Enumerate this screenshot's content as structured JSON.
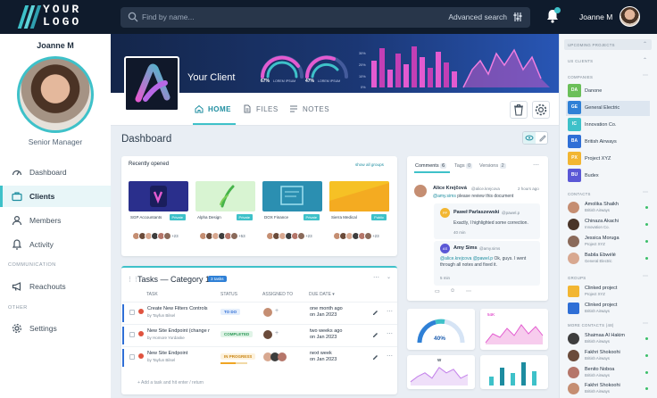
{
  "app": {
    "logo_text": "YOUR LOGO",
    "search": {
      "placeholder": "Find by name...",
      "advanced_label": "Advanced search"
    },
    "user_name": "Joanne M"
  },
  "sidebar": {
    "name": "Joanne M",
    "role": "Senior Manager",
    "items": [
      {
        "label": "Dashboard",
        "icon": "dashboard-icon"
      },
      {
        "label": "Clients",
        "icon": "briefcase-icon",
        "active": true
      },
      {
        "label": "Members",
        "icon": "user-icon"
      },
      {
        "label": "Activity",
        "icon": "bell-icon"
      }
    ],
    "section_communication": "COMMUNICATION",
    "communication_items": [
      {
        "label": "Reachouts",
        "icon": "megaphone-icon"
      }
    ],
    "section_other": "OTHER",
    "other_items": [
      {
        "label": "Settings",
        "icon": "gear-icon"
      }
    ]
  },
  "client": {
    "name": "Your Client",
    "hero_stats": [
      {
        "value": "67%",
        "label": "LOREM IPSUM"
      },
      {
        "value": "47%",
        "label": "LOREM IPSUM"
      }
    ],
    "hero_axis": [
      "30%",
      "20%",
      "10%",
      "0%"
    ],
    "tabs": [
      {
        "label": "HOME",
        "icon": "home-icon",
        "active": true
      },
      {
        "label": "FILES",
        "icon": "file-icon"
      },
      {
        "label": "NOTES",
        "icon": "notes-icon"
      }
    ]
  },
  "dashboard": {
    "title": "Dashboard",
    "recently_opened": {
      "title": "Recently opened",
      "view_all": "show all groups",
      "items": [
        {
          "name": "SGP Accountants",
          "badge": "Private",
          "count": "+23",
          "thumb": "#2a2f8c"
        },
        {
          "name": "Alpha Design",
          "badge": "Private",
          "count": "+53",
          "thumb": "#d8f4d2"
        },
        {
          "name": "DOX Finance",
          "badge": "Private",
          "count": "+23",
          "thumb": "#2b8fb1"
        },
        {
          "name": "Sierra Medical",
          "badge": "Public",
          "count": "+23",
          "thumb": "#f6c125"
        }
      ]
    },
    "tasks": {
      "title": "Tasks — Category 1",
      "count_badge": "3 tasks",
      "columns": [
        "TASK",
        "STATUS",
        "ASSIGNED TO",
        "DUE DATE ▾"
      ],
      "rows": [
        {
          "title": "Create New Filters Controls",
          "by": "by Tayfun Bilsel",
          "status": "TO DO",
          "status_color": "#2f6fd6",
          "status_bg": "#e4eefc",
          "due": "one month ago",
          "due_date": "on Jan 2023"
        },
        {
          "title": "New Site Endpoint (change r",
          "by": "by Homore Yordaske",
          "status": "COMPLETED",
          "status_color": "#2e9a58",
          "status_bg": "#e0f4e7",
          "due": "two weeks ago",
          "due_date": "on Jan 2023"
        },
        {
          "title": "New Site Endpoint",
          "by": "by Tayfun Bilsel",
          "status": "IN PROGRESS",
          "status_color": "#c98410",
          "status_bg": "#fdf2dd",
          "due": "next week",
          "due_date": "on Jan 2023"
        }
      ],
      "add_placeholder": "Add a task and hit enter / return"
    },
    "comments": {
      "tabs": [
        "Comments",
        "Tags",
        "Versions"
      ],
      "tab_counts": [
        "6",
        "0",
        "2"
      ],
      "thread": [
        {
          "author": "Alice Krejčová",
          "handle": "@alice.krejcova",
          "time": "2 hours ago",
          "mention": "@amy.sims",
          "text": "please review this document"
        },
        {
          "author": "Paweł Parlaszewski",
          "handle": "@pawel.p",
          "text": "Exactly, I highlighted some correction.",
          "time": "40 min",
          "initials": "PP"
        },
        {
          "author": "Amy Sims",
          "handle": "@amy.sims",
          "initials": "AS",
          "mention": "@alice.krejcova",
          "mention2": "@pawel.p",
          "text": "Ok, guys. I went through all notes and fixed it.",
          "time": "5 min"
        }
      ]
    },
    "mini_charts": {
      "gauge_value": "40%",
      "area_label": "54K",
      "line_label": "W"
    }
  },
  "right_sidebar": {
    "upcoming": "UPCOMING PROJECTS",
    "clients": "US CLIENTS",
    "companies_label": "COMPANIES",
    "companies": [
      {
        "abbr": "DA",
        "name": "Danone",
        "color": "#6bbf59"
      },
      {
        "abbr": "GE",
        "name": "General Electric",
        "color": "#2f80d6"
      },
      {
        "abbr": "IC",
        "name": "Innovation Co.",
        "color": "#3ec1c9"
      },
      {
        "abbr": "BA",
        "name": "British Airways",
        "color": "#2f6fd6"
      },
      {
        "abbr": "PX",
        "name": "Project XYZ",
        "color": "#f2b632"
      },
      {
        "abbr": "BU",
        "name": "Budex",
        "color": "#5b58d6"
      }
    ],
    "contacts_label": "CONTACTS",
    "contacts": [
      {
        "name": "Amolika Shaikh",
        "company": "British Airways"
      },
      {
        "name": "Chinaza Akachi",
        "company": "Innovation Co."
      },
      {
        "name": "Jessica Moruga",
        "company": "Project XYZ"
      },
      {
        "name": "Babila Ebwélé",
        "company": "General Electric"
      }
    ],
    "groups_label": "GROUPS",
    "groups": [
      {
        "name": "Clinked project",
        "company": "Project XYZ"
      },
      {
        "name": "Clinked project",
        "company": "British Airways"
      }
    ],
    "more_contacts_label": "MORE CONTACTS (48)",
    "more_contacts": [
      {
        "name": "Shaimaa Al Hakim",
        "company": "British Airways"
      },
      {
        "name": "Fakhri Shokoohi",
        "company": "British Airways"
      },
      {
        "name": "Benito Noboa",
        "company": "British Airways"
      },
      {
        "name": "Fakhri Shokoohi",
        "company": "British Airways"
      }
    ]
  },
  "colors": {
    "accent": "#3ec1c9",
    "topbar": "#0f1b2c",
    "hero_pink": "#e35bd0"
  }
}
